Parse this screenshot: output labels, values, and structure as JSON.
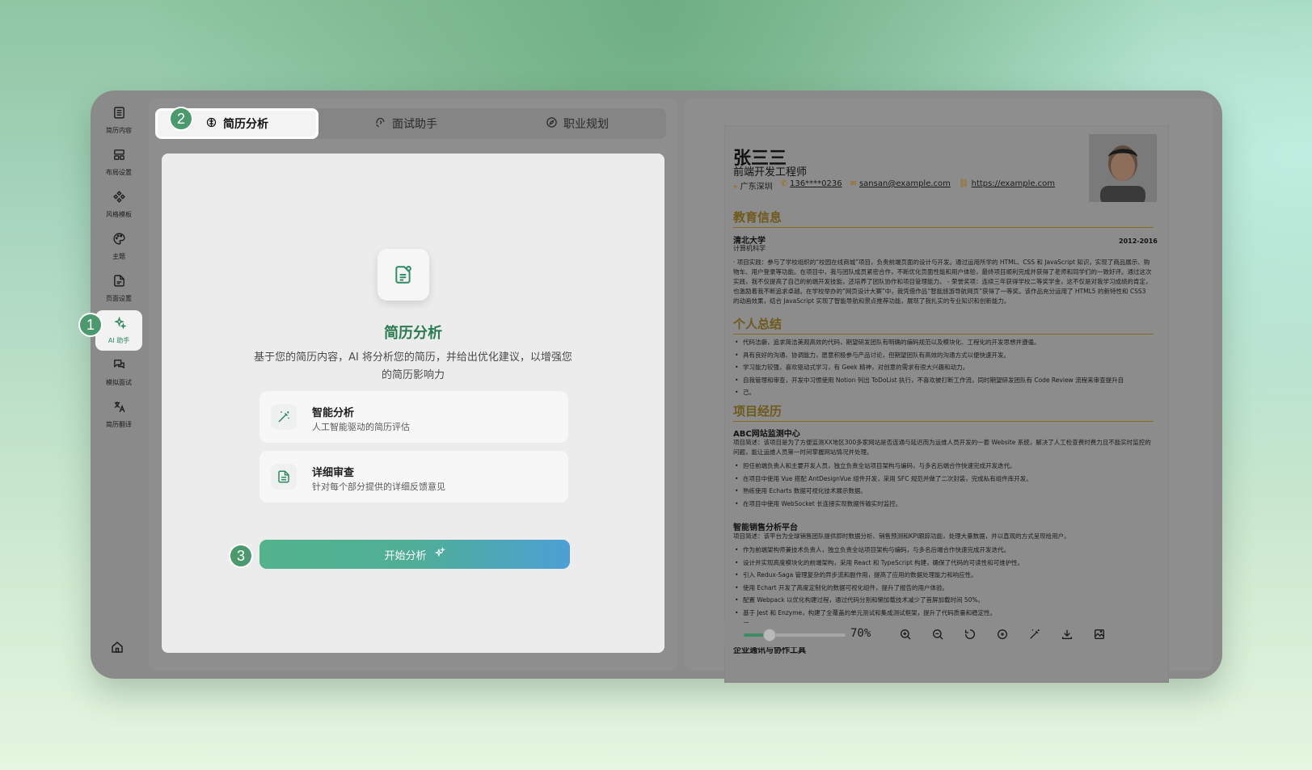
{
  "sidebar": {
    "items": [
      {
        "label": "简历内容",
        "icon": "list-icon"
      },
      {
        "label": "布局设置",
        "icon": "layout-icon"
      },
      {
        "label": "风格模板",
        "icon": "template-icon"
      },
      {
        "label": "主题",
        "icon": "palette-icon"
      },
      {
        "label": "页面设置",
        "icon": "page-icon"
      },
      {
        "label": "AI 助手",
        "icon": "sparkles-icon",
        "active": true
      },
      {
        "label": "模拟面试",
        "icon": "chat-icon"
      },
      {
        "label": "简历翻译",
        "icon": "translate-icon"
      }
    ],
    "home_icon": "home-icon"
  },
  "markers": [
    "1",
    "2",
    "3"
  ],
  "tabs": [
    {
      "label": "简历分析",
      "icon": "brain-icon",
      "active": true
    },
    {
      "label": "面试助手",
      "icon": "headset-icon"
    },
    {
      "label": "职业规划",
      "icon": "compass-icon"
    }
  ],
  "analysis": {
    "title": "简历分析",
    "description": "基于您的简历内容，AI 将分析您的简历，并给出优化建议，以增强您的简历影响力",
    "features": [
      {
        "title": "智能分析",
        "subtitle": "人工智能驱动的简历评估",
        "icon": "magic-wand-icon"
      },
      {
        "title": "详细审查",
        "subtitle": "针对每个部分提供的详细反馈意见",
        "icon": "document-icon"
      }
    ],
    "start_button": "开始分析"
  },
  "resume": {
    "name": "张三三",
    "role": "前端开发工程师",
    "contact": {
      "location": "广东深圳",
      "phone": "136****0236",
      "email": "sansan@example.com",
      "website": "https://example.com"
    },
    "education_title": "教育信息",
    "school": "清北大学",
    "years": "2012-2016",
    "major": "计算机科学",
    "education_text": "· 项目实践：参与了学校组织的“校园在线商城”项目，负责前端页面的设计与开发。通过运用所学的 HTML、CSS 和 JavaScript 知识，实现了商品展示、购物车、用户登录等功能。在项目中，我与团队成员紧密合作，不断优化页面性能和用户体验，最终项目顺利完成并获得了老师和同学们的一致好评。通过这次实践，我不仅提高了自己的前端开发技能，还培养了团队协作和项目管理能力。 - 荣誉奖项：连续三年获得学校二等奖学金，这不仅是对我学习成绩的肯定，也激励着我不断追求卓越。在学校举办的“网页设计大赛”中，我凭借作品“智能旅游导航网页”获得了一等奖。该作品充分运用了 HTML5 的新特性和 CSS3 的动画效果，结合 JavaScript 实现了智能导航和景点推荐功能，展现了我扎实的专业知识和创新能力。",
    "summary_title": "个人总结",
    "summary": [
      "代码洁癖，追求简洁美观高效的代码，期望研发团队有明确的编码规范以及模块化、工程化的开发思想并遵循。",
      "具有良好的沟通、协调能力，愿意积极参与产品讨论，但期望团队有高效的沟通方式以便快速开发。",
      "学习能力较强，喜欢驱动式学习，有 Geek 精神，对创意的需求有很大兴趣和动力。",
      "自我管理和审查，开发中习惯使用 Notion 列出 ToDoList 执行，不喜欢被打断工作流，同时期望研发团队有 Code Review 流程来审查提升自",
      "己。"
    ],
    "projects_title": "项目经历",
    "project1": {
      "name": "ABC网站监测中心",
      "desc": "项目简述：该项目是为了方便监测XX地区300多家网站是否连通与延迟而为运维人员开发的一套 Website 系统，解决了人工检查费时费力且不能实时监控的问题，能让运维人员第一时间掌握网站情况并处理。",
      "bullets": [
        "担任前端负责人和主要开发人员，独立负责全站项目架构与编码，与多名后端合作快速完成开发迭代。",
        "在项目中使用 Vue 搭配 AntDesignVue 组件开发，采用 SFC 规范并做了二次封装，完成私有组件库开发。",
        "熟练使用 Echarts 数据可视化技术展示数据。",
        "在项目中使用 WebSocket 长连接实现数据传输实时监控。"
      ]
    },
    "project2": {
      "name": "智能销售分析平台",
      "desc": "项目简述：该平台为全球销售团队提供即时数据分析、销售预测和KPI跟踪功能，处理大量数据，并以直观的方式呈现给用户。",
      "bullets": [
        "作为前端架构师兼技术负责人，独立负责全站项目架构与编码，与多名后端合作快速完成开发迭代。",
        "设计并实现高度模块化的前端架构，采用 React 和 TypeScript 构建，确保了代码的可读性和可维护性。",
        "引入 Redux-Saga 管理复杂的异步流和副作用，提高了应用的数据处理能力和响应性。",
        "使用 Echart 开发了高度定制化的数据可视化组件，提升了报告的用户体验。",
        "配置 Webpack 以优化构建过程，通过代码分割和懒加载技术减少了首屏加载时间 50%。",
        "基于 Jest 和 Enzyme，构建了全覆盖的单元测试和集成测试框架，提升了代码质量和稳定性。",
        "促"
      ]
    },
    "project3_name": "企业通讯与协作工具"
  },
  "toolbar": {
    "zoom": "70%",
    "zoom_fraction": 0.25,
    "icons": [
      "zoom-in-icon",
      "zoom-out-icon",
      "reset-icon",
      "center-icon",
      "magic-icon",
      "download-icon",
      "image-export-icon"
    ]
  }
}
